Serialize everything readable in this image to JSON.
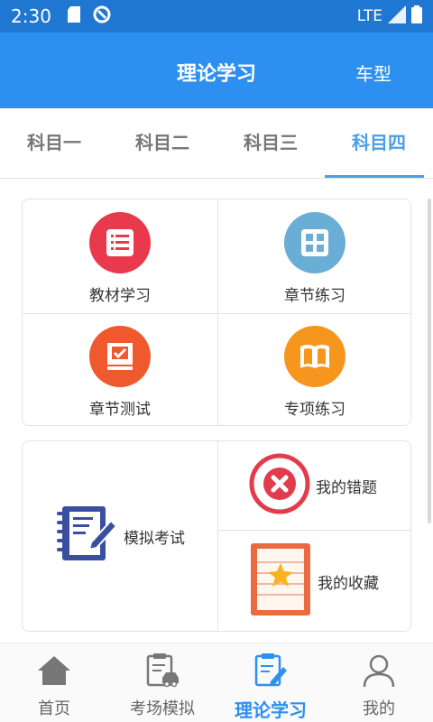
{
  "status_bar": {
    "time": "2:30",
    "network": "LTE",
    "icons": [
      "sd-card-icon",
      "no-disturb-icon",
      "signal-icon",
      "battery-icon"
    ]
  },
  "app_bar": {
    "title": "理论学习",
    "right_action": "车型"
  },
  "tabs": [
    {
      "label": "科目一",
      "active": false
    },
    {
      "label": "科目二",
      "active": false
    },
    {
      "label": "科目三",
      "active": false
    },
    {
      "label": "科目四",
      "active": true
    }
  ],
  "grid": [
    {
      "label": "教材学习",
      "icon": "textbook-icon",
      "color": "#e8394d"
    },
    {
      "label": "章节练习",
      "icon": "grid-icon",
      "color": "#6aaed6"
    },
    {
      "label": "章节测试",
      "icon": "test-icon",
      "color": "#f0582e"
    },
    {
      "label": "专项练习",
      "icon": "book-icon",
      "color": "#f7961f"
    }
  ],
  "exam": {
    "mock": {
      "label": "模拟考试",
      "icon": "notebook-pen-icon"
    },
    "wrong": {
      "label": "我的错题",
      "icon": "wrong-x-icon"
    },
    "favorites": {
      "label": "我的收藏",
      "icon": "star-note-icon"
    }
  },
  "bottom_nav": [
    {
      "label": "首页",
      "icon": "home-icon",
      "active": false
    },
    {
      "label": "考场模拟",
      "icon": "exam-car-icon",
      "active": false
    },
    {
      "label": "理论学习",
      "icon": "study-pen-icon",
      "active": true
    },
    {
      "label": "我的",
      "icon": "user-icon",
      "active": false
    }
  ],
  "colors": {
    "status_bar": "#1f77d2",
    "app_bar": "#2d8ff0",
    "tab_active": "#4a9ee6"
  }
}
